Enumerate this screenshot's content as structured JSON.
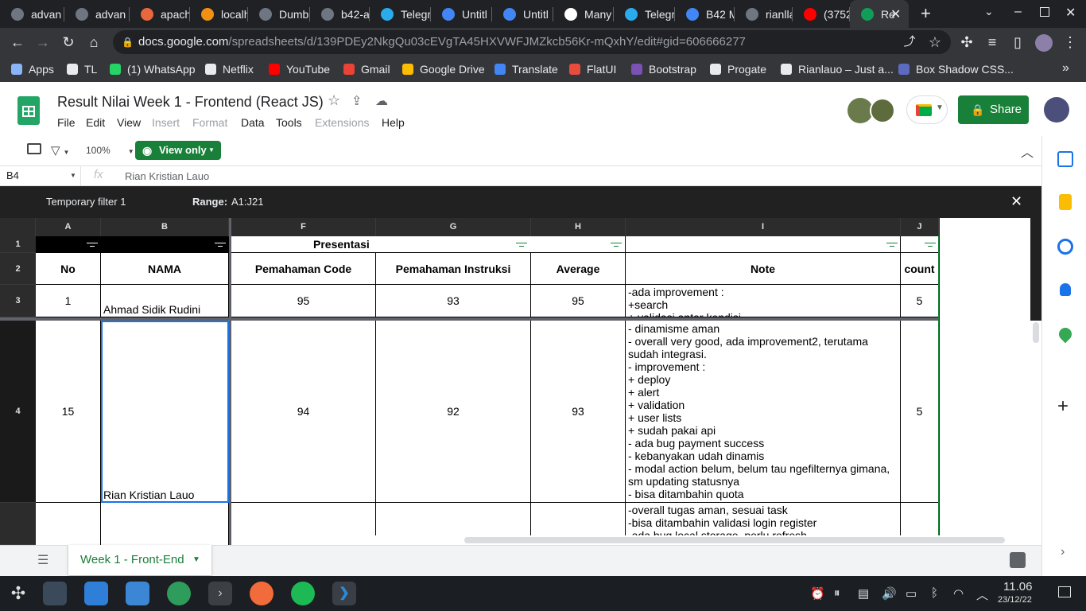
{
  "browser": {
    "tabs": [
      {
        "label": "advan",
        "color": "#6e7681"
      },
      {
        "label": "advan",
        "color": "#6e7681"
      },
      {
        "label": "apach",
        "color": "#e8673c"
      },
      {
        "label": "localh",
        "color": "#f29111"
      },
      {
        "label": "Dumb",
        "color": "#6e7681"
      },
      {
        "label": "b42-a",
        "color": "#6e7681"
      },
      {
        "label": "Telegr",
        "color": "#2aabee"
      },
      {
        "label": "Untitl",
        "color": "#4285f4"
      },
      {
        "label": "Untitl",
        "color": "#4285f4"
      },
      {
        "label": "Many",
        "color": "#ffffff"
      },
      {
        "label": "Telegr",
        "color": "#2aabee"
      },
      {
        "label": "B42 M",
        "color": "#4285f4"
      },
      {
        "label": "rianlla",
        "color": "#6e7681"
      },
      {
        "label": "(3752)",
        "color": "#ff0000"
      },
      {
        "label": "Re",
        "color": "#0f9d58"
      }
    ],
    "new_tab_glyph": "+",
    "url_domain": "docs.google.com",
    "url_path": "/spreadsheets/d/139PDEy2NkgQu03cEVgTA45HXVWFJMZkcb56Kr-mQxhY/edit#gid=606666277",
    "bookmarks": [
      {
        "label": "Apps",
        "color": "#8ab4f8"
      },
      {
        "label": "TL",
        "color": "#e8eaed"
      },
      {
        "label": "(1) WhatsApp",
        "color": "#25d366"
      },
      {
        "label": "Netflix",
        "color": "#e8eaed"
      },
      {
        "label": "YouTube",
        "color": "#ff0000"
      },
      {
        "label": "Gmail",
        "color": "#ea4335"
      },
      {
        "label": "Google Drive",
        "color": "#fbbc04"
      },
      {
        "label": "Translate",
        "color": "#4285f4"
      },
      {
        "label": "FlatUI",
        "color": "#e74c3c"
      },
      {
        "label": "Bootstrap",
        "color": "#7952b3"
      },
      {
        "label": "Progate",
        "color": "#e8eaed"
      },
      {
        "label": "Rianlauo – Just a...",
        "color": "#e8eaed"
      },
      {
        "label": "Box Shadow CSS...",
        "color": "#5c6bc0"
      }
    ],
    "more_glyph": "»"
  },
  "sheets": {
    "title": "Result Nilai Week 1 - Frontend (React JS)",
    "menus": [
      {
        "label": "File",
        "enabled": true
      },
      {
        "label": "Edit",
        "enabled": true
      },
      {
        "label": "View",
        "enabled": true
      },
      {
        "label": "Insert",
        "enabled": false
      },
      {
        "label": "Format",
        "enabled": false
      },
      {
        "label": "Data",
        "enabled": true
      },
      {
        "label": "Tools",
        "enabled": true
      },
      {
        "label": "Extensions",
        "enabled": false
      },
      {
        "label": "Help",
        "enabled": true
      }
    ],
    "share_label": "Share",
    "zoom": "100%",
    "view_only_label": "View only",
    "cell_ref": "B4",
    "fx_label": "fx",
    "formula_value": "Rian Kristian Lauo",
    "filter": {
      "name": "Temporary filter 1",
      "range_label": "Range:",
      "range_value": "A1:J21"
    },
    "columns": [
      "A",
      "B",
      "F",
      "G",
      "H",
      "I",
      "J"
    ],
    "rows": [
      "1",
      "2",
      "3",
      "4"
    ],
    "merged_header": "Presentasi",
    "headers": [
      "No",
      "NAMA",
      "Pemahaman Code",
      "Pemahaman Instruksi",
      "Average",
      "Note",
      "count"
    ],
    "data_rows": [
      {
        "no": "1",
        "nama": "Ahmad Sidik Rudini",
        "code": "95",
        "instruksi": "93",
        "average": "95",
        "note": "-ada improvement :\n+search\n+ validasi antar kondisi",
        "count": "5"
      },
      {
        "no": "15",
        "nama": "Rian Kristian Lauo",
        "code": "94",
        "instruksi": "92",
        "average": "93",
        "note": "- dinamisme aman\n- overall very good, ada improvement2, terutama sudah integrasi.\n- improvement :\n+ deploy\n+ alert\n+ validation\n+ user lists\n+ sudah pakai api\n- ada bug payment success\n- kebanyakan udah dinamis\n- modal action belum, belum tau ngefilternya gimana, sm updating statusnya\n- bisa ditambahin quota",
        "count": "5"
      },
      {
        "no": "",
        "nama": "",
        "code": "",
        "instruksi": "",
        "average": "",
        "note": "-overall tugas aman, sesuai task\n-bisa ditambahin validasi login register\n-ada bug local storage, perlu refresh",
        "count": ""
      }
    ],
    "sheet_tab": "Week 1 - Front-End"
  },
  "taskbar": {
    "time": "11.06",
    "date": "23/12/22"
  }
}
